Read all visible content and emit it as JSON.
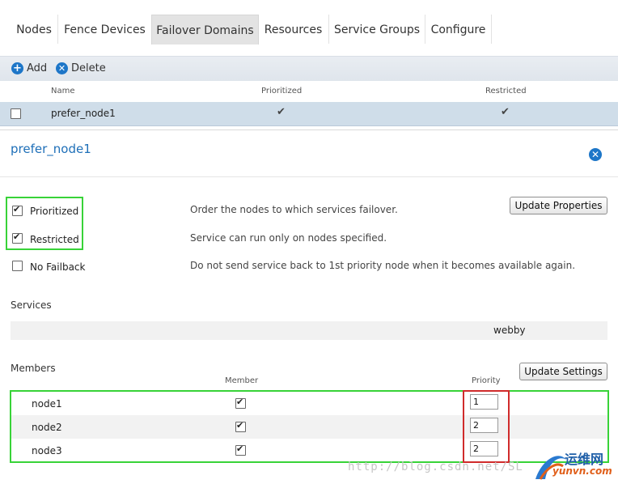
{
  "tabs": [
    {
      "label": "Nodes"
    },
    {
      "label": "Fence Devices"
    },
    {
      "label": "Failover Domains"
    },
    {
      "label": "Resources"
    },
    {
      "label": "Service Groups"
    },
    {
      "label": "Configure"
    }
  ],
  "toolbar": {
    "add_label": "Add",
    "delete_label": "Delete"
  },
  "table": {
    "headers": {
      "name": "Name",
      "prioritized": "Prioritized",
      "restricted": "Restricted"
    },
    "rows": [
      {
        "name": "prefer_node1",
        "prioritized": true,
        "restricted": true,
        "selected": false
      }
    ]
  },
  "detail": {
    "title": "prefer_node1",
    "options": [
      {
        "label": "Prioritized",
        "checked": true,
        "description": "Order the nodes to which services failover."
      },
      {
        "label": "Restricted",
        "checked": true,
        "description": "Service can run only on nodes specified."
      },
      {
        "label": "No Failback",
        "checked": false,
        "description": "Do not send service back to 1st priority node when it becomes available again."
      }
    ],
    "update_properties_label": "Update Properties",
    "services_label": "Services",
    "services": [
      "webby"
    ],
    "members_label": "Members",
    "member_col": "Member",
    "priority_col": "Priority",
    "update_settings_label": "Update Settings",
    "members": [
      {
        "name": "node1",
        "member": true,
        "priority": "1"
      },
      {
        "name": "node2",
        "member": true,
        "priority": "2"
      },
      {
        "name": "node3",
        "member": true,
        "priority": "2"
      }
    ]
  },
  "watermark": {
    "text": "http://blog.csdn.net/SL"
  },
  "logo": {
    "text": "运维网",
    "sub": "yunvn.com"
  },
  "colors": {
    "accent": "#1d76c8",
    "highlight_green": "#38d338",
    "highlight_red": "#d02b2b",
    "selected_row": "#cfdde9"
  }
}
